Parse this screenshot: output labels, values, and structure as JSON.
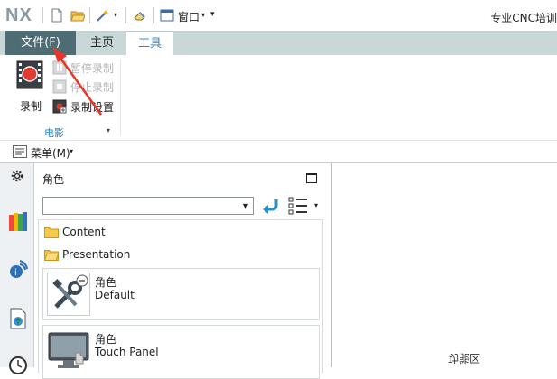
{
  "app": {
    "logo": "NX",
    "title": "专业CNC培训"
  },
  "quick_access": {
    "window_menu": "窗口"
  },
  "tabs": [
    {
      "label": "文件(F)"
    },
    {
      "label": "主页"
    },
    {
      "label": "工具"
    }
  ],
  "ribbon": {
    "record_label": "录制",
    "pause_label": "暂停录制",
    "stop_label": "停止录制",
    "settings_label": "录制设置",
    "group_label": "电影"
  },
  "menu": {
    "label": "菜单(M)"
  },
  "panel": {
    "title": "角色",
    "select_value": "",
    "folders": [
      {
        "label": "Content"
      },
      {
        "label": "Presentation"
      }
    ],
    "roles": [
      {
        "title": "角色",
        "subtitle": "Default",
        "icon": "tools-icon"
      },
      {
        "title": "角色",
        "subtitle": "Touch Panel",
        "icon": "touch-panel-icon"
      }
    ]
  },
  "graphics": {
    "mirrored_text": "功能区"
  },
  "colors": {
    "file_tab": "#4e6c74",
    "tab_bar": "#c9d7d8",
    "active_tab_text": "#2a84c5",
    "annotation_arrow": "#e8352a"
  }
}
